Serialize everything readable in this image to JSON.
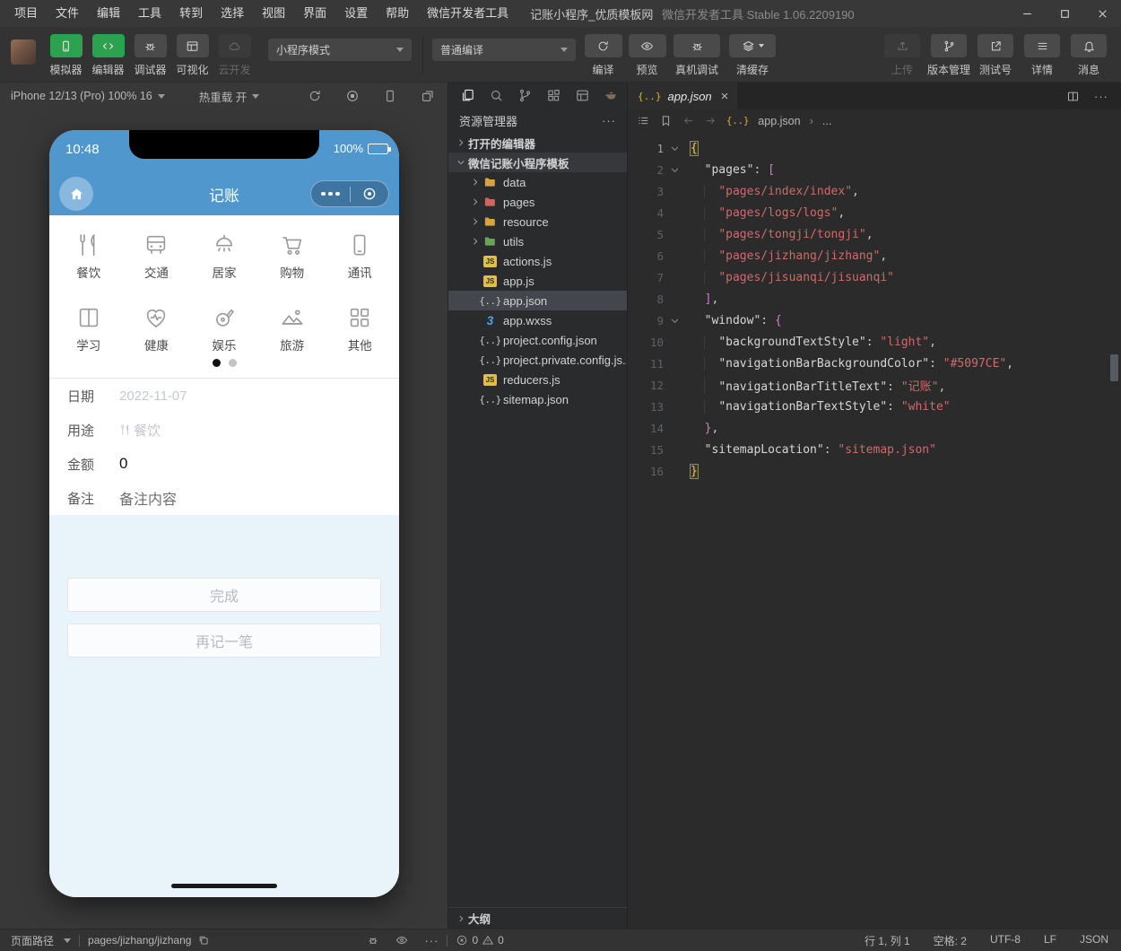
{
  "titlebar": {
    "menus": [
      "项目",
      "文件",
      "编辑",
      "工具",
      "转到",
      "选择",
      "视图",
      "界面",
      "设置",
      "帮助",
      "微信开发者工具"
    ],
    "project_title": "记账小程序_优质模板网",
    "app_title": "微信开发者工具 Stable 1.06.2209190"
  },
  "toolbar": {
    "toggles": [
      {
        "id": "simulator",
        "label": "模拟器",
        "icon": "phone",
        "state": "active"
      },
      {
        "id": "editor",
        "label": "编辑器",
        "icon": "code",
        "state": "active"
      },
      {
        "id": "debugger",
        "label": "调试器",
        "icon": "bug",
        "state": "normal"
      },
      {
        "id": "visualizer",
        "label": "可视化",
        "icon": "layout",
        "state": "normal"
      },
      {
        "id": "cloud-dev",
        "label": "云开发",
        "icon": "cloud",
        "state": "disabled"
      }
    ],
    "mode_dropdown": "小程序模式",
    "compile_dropdown": "普通编译",
    "compile_actions": [
      {
        "id": "compile",
        "label": "编译",
        "icon": "refresh",
        "wide": false,
        "caret": false
      },
      {
        "id": "preview",
        "label": "预览",
        "icon": "eye",
        "wide": false,
        "caret": false
      },
      {
        "id": "remote-debug",
        "label": "真机调试",
        "icon": "bug",
        "wide": true,
        "caret": false
      },
      {
        "id": "clear-cache",
        "label": "清缓存",
        "icon": "layers",
        "wide": true,
        "caret": true
      }
    ],
    "right_actions": [
      {
        "id": "upload",
        "label": "上传",
        "icon": "upload",
        "state": "disabled"
      },
      {
        "id": "version-control",
        "label": "版本管理",
        "icon": "branch",
        "state": "normal"
      },
      {
        "id": "test-account",
        "label": "测试号",
        "icon": "external",
        "state": "normal"
      },
      {
        "id": "details",
        "label": "详情",
        "icon": "menu",
        "state": "normal"
      },
      {
        "id": "messages",
        "label": "消息",
        "icon": "bell",
        "state": "normal"
      }
    ]
  },
  "simulator": {
    "device_label": "iPhone 12/13 (Pro) 100% 16",
    "hot_reload_label": "热重载 开",
    "phone": {
      "status_time": "10:48",
      "battery": "100%",
      "nav_title": "记账",
      "categories": [
        {
          "label": "餐饮",
          "icon": "food"
        },
        {
          "label": "交通",
          "icon": "bus"
        },
        {
          "label": "居家",
          "icon": "lamp"
        },
        {
          "label": "购物",
          "icon": "cart"
        },
        {
          "label": "通讯",
          "icon": "mobile"
        },
        {
          "label": "学习",
          "icon": "book"
        },
        {
          "label": "健康",
          "icon": "health"
        },
        {
          "label": "娱乐",
          "icon": "fun"
        },
        {
          "label": "旅游",
          "icon": "travel"
        },
        {
          "label": "其他",
          "icon": "grid"
        }
      ],
      "form": [
        {
          "label": "日期",
          "value": "2022-11-07",
          "style": "muted",
          "value_icon": ""
        },
        {
          "label": "用途",
          "value": "餐饮",
          "style": "muted",
          "value_icon": "food"
        },
        {
          "label": "金额",
          "value": "0",
          "style": "strong",
          "value_icon": ""
        },
        {
          "label": "备注",
          "value": "备注内容",
          "style": "half",
          "value_icon": ""
        }
      ],
      "buttons": [
        "完成",
        "再记一笔"
      ]
    }
  },
  "explorer": {
    "title": "资源管理器",
    "sections": [
      {
        "label": "打开的编辑器",
        "expanded": false,
        "highlight": false
      },
      {
        "label": "微信记账小程序模板",
        "expanded": true,
        "highlight": true
      }
    ],
    "tree": [
      {
        "name": "data",
        "type": "folder",
        "color": "#d9a33c",
        "selected": false
      },
      {
        "name": "pages",
        "type": "folder",
        "color": "#cf6659",
        "selected": false
      },
      {
        "name": "resource",
        "type": "folder",
        "color": "#d9a33c",
        "selected": false
      },
      {
        "name": "utils",
        "type": "folder",
        "color": "#67a557",
        "selected": false
      },
      {
        "name": "actions.js",
        "type": "js",
        "selected": false
      },
      {
        "name": "app.js",
        "type": "js",
        "selected": false
      },
      {
        "name": "app.json",
        "type": "json",
        "selected": true
      },
      {
        "name": "app.wxss",
        "type": "wxss",
        "selected": false
      },
      {
        "name": "project.config.json",
        "type": "json",
        "selected": false
      },
      {
        "name": "project.private.config.js...",
        "type": "json",
        "selected": false
      },
      {
        "name": "reducers.js",
        "type": "js",
        "selected": false
      },
      {
        "name": "sitemap.json",
        "type": "json",
        "selected": false
      }
    ],
    "outline_label": "大纲"
  },
  "editor": {
    "tab_label": "app.json",
    "tab_icon_text": "{..}",
    "breadcrumb_file": "app.json",
    "breadcrumb_separator": "›",
    "breadcrumb_more": "...",
    "code": [
      {
        "n": 1,
        "fold": true,
        "cur": true,
        "tokens": [
          {
            "t": "{",
            "c": "match"
          }
        ]
      },
      {
        "n": 2,
        "fold": true,
        "tokens": [
          {
            "t": "  "
          },
          {
            "t": "\"pages\"",
            "c": "key"
          },
          {
            "t": ": "
          },
          {
            "t": "[",
            "c": "brk"
          }
        ]
      },
      {
        "n": 3,
        "g": true,
        "tokens": [
          {
            "t": "    "
          },
          {
            "t": "\"pages/index/index\"",
            "c": "str"
          },
          {
            "t": ","
          }
        ]
      },
      {
        "n": 4,
        "g": true,
        "tokens": [
          {
            "t": "    "
          },
          {
            "t": "\"pages/logs/logs\"",
            "c": "str"
          },
          {
            "t": ","
          }
        ]
      },
      {
        "n": 5,
        "g": true,
        "tokens": [
          {
            "t": "    "
          },
          {
            "t": "\"pages/tongji/tongji\"",
            "c": "str"
          },
          {
            "t": ","
          }
        ]
      },
      {
        "n": 6,
        "g": true,
        "tokens": [
          {
            "t": "    "
          },
          {
            "t": "\"pages/jizhang/jizhang\"",
            "c": "str"
          },
          {
            "t": ","
          }
        ]
      },
      {
        "n": 7,
        "g": true,
        "tokens": [
          {
            "t": "    "
          },
          {
            "t": "\"pages/jisuanqi/jisuanqi\"",
            "c": "str"
          }
        ]
      },
      {
        "n": 8,
        "tokens": [
          {
            "t": "  "
          },
          {
            "t": "]",
            "c": "brk"
          },
          {
            "t": ","
          }
        ]
      },
      {
        "n": 9,
        "fold": true,
        "tokens": [
          {
            "t": "  "
          },
          {
            "t": "\"window\"",
            "c": "key"
          },
          {
            "t": ": "
          },
          {
            "t": "{",
            "c": "brk"
          }
        ]
      },
      {
        "n": 10,
        "g": true,
        "tokens": [
          {
            "t": "    "
          },
          {
            "t": "\"backgroundTextStyle\"",
            "c": "key"
          },
          {
            "t": ": "
          },
          {
            "t": "\"light\"",
            "c": "str"
          },
          {
            "t": ","
          }
        ]
      },
      {
        "n": 11,
        "g": true,
        "tokens": [
          {
            "t": "    "
          },
          {
            "t": "\"navigationBarBackgroundColor\"",
            "c": "key"
          },
          {
            "t": ": "
          },
          {
            "t": "\"#5097CE\"",
            "c": "str"
          },
          {
            "t": ","
          }
        ]
      },
      {
        "n": 12,
        "g": true,
        "tokens": [
          {
            "t": "    "
          },
          {
            "t": "\"navigationBarTitleText\"",
            "c": "key"
          },
          {
            "t": ": "
          },
          {
            "t": "\"记账\"",
            "c": "str"
          },
          {
            "t": ","
          }
        ]
      },
      {
        "n": 13,
        "g": true,
        "tokens": [
          {
            "t": "    "
          },
          {
            "t": "\"navigationBarTextStyle\"",
            "c": "key"
          },
          {
            "t": ": "
          },
          {
            "t": "\"white\"",
            "c": "str"
          }
        ]
      },
      {
        "n": 14,
        "tokens": [
          {
            "t": "  "
          },
          {
            "t": "}",
            "c": "brk"
          },
          {
            "t": ","
          }
        ]
      },
      {
        "n": 15,
        "tokens": [
          {
            "t": "  "
          },
          {
            "t": "\"sitemapLocation\"",
            "c": "key"
          },
          {
            "t": ": "
          },
          {
            "t": "\"sitemap.json\"",
            "c": "str"
          }
        ]
      },
      {
        "n": 16,
        "tokens": [
          {
            "t": "}",
            "c": "match"
          }
        ]
      }
    ]
  },
  "statusbar": {
    "page_path_label": "页面路径",
    "page_path": "pages/jizhang/jizhang",
    "errors": "0",
    "warnings": "0",
    "cursor": "行 1, 列 1",
    "spaces": "空格: 2",
    "encoding": "UTF-8",
    "eol": "LF",
    "language": "JSON"
  },
  "colors": {
    "accent_green": "#2ba24f",
    "phone_blue": "#5097CE"
  }
}
